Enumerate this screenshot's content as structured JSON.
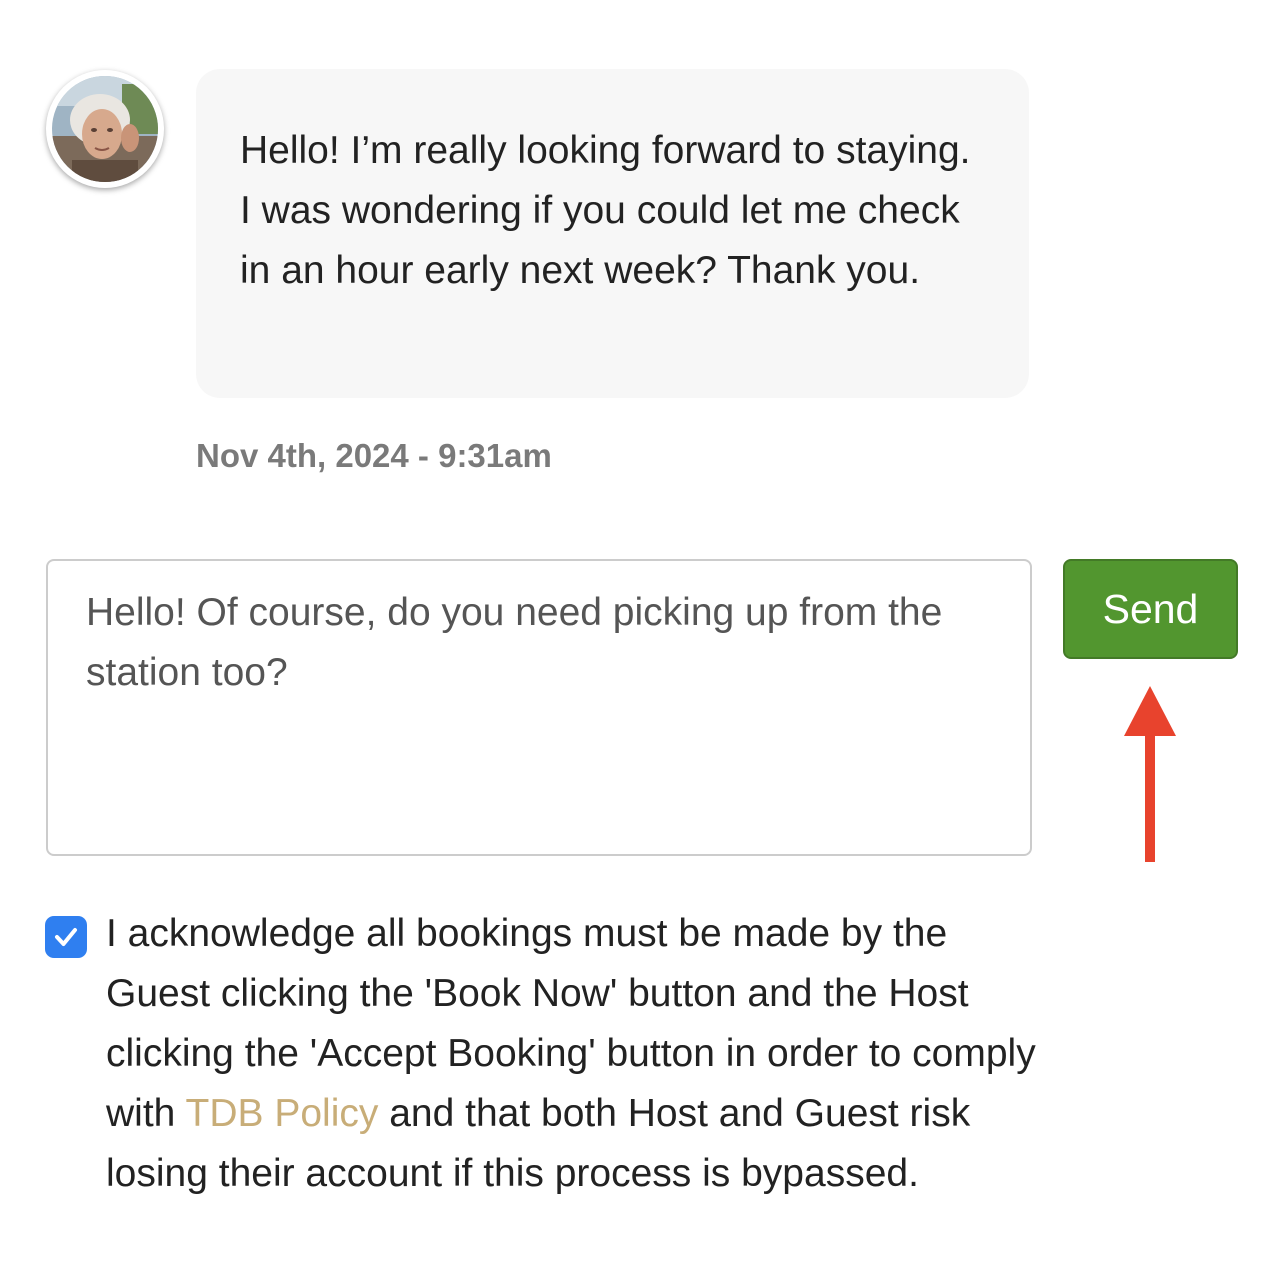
{
  "conversation": {
    "sender_avatar_alt": "guest-avatar",
    "message_text": "Hello! I’m really looking forward to staying. I was wondering if you could let me check in an hour early next week? Thank you.",
    "timestamp": "Nov 4th, 2024 - 9:31am"
  },
  "reply": {
    "value": "Hello! Of course, do you need picking up from the station too?",
    "send_label": "Send"
  },
  "acknowledgement": {
    "checked": true,
    "text_before": "I acknowledge all bookings must be made by the Guest clicking the 'Book Now' button and the Host clicking the 'Accept Booking' button in order to comply with ",
    "link_text": "TDB Policy",
    "text_after": " and that both Host and Guest risk losing their account if this process is bypassed."
  },
  "colors": {
    "send_button": "#52962f",
    "checkbox": "#2f7ff0",
    "policy_link": "#c8ad78",
    "annotation_arrow": "#e8432d",
    "bubble_background": "#f7f7f7",
    "timestamp": "#7a7a7a"
  },
  "icons": {
    "checkbox_mark": "checkmark-icon",
    "annotation": "up-arrow-icon"
  }
}
